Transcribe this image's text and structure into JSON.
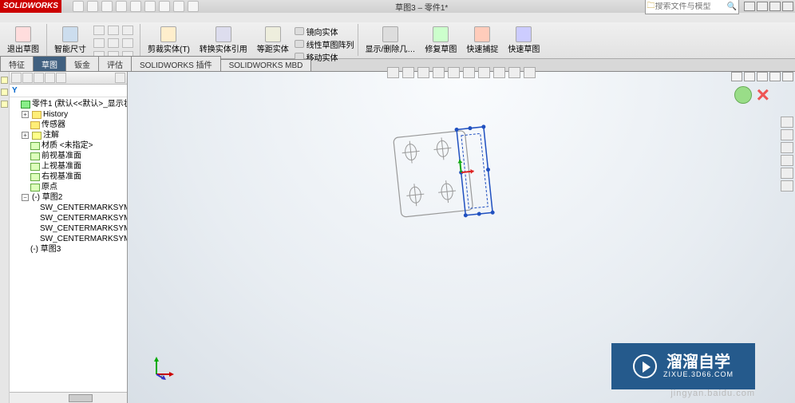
{
  "app": {
    "name": "SOLIDWORKS",
    "doc_title": "草图3 – 零件1*"
  },
  "search": {
    "placeholder": "搜索文件与模型"
  },
  "ribbon": {
    "exit_sketch": "退出草图",
    "smart_dim": "智能尺寸",
    "trim": "剪裁实体(T)",
    "convert": "转换实体引用",
    "offset": "等距实体",
    "mirror": "镜向实体",
    "linear_pattern": "线性草图阵列",
    "move": "移动实体",
    "display_delete": "显示/删除几…",
    "repair": "修复草图",
    "quick_snap": "快速捕捉",
    "quick_sketch": "快速草图"
  },
  "tabs": {
    "items": [
      "特征",
      "草图",
      "钣金",
      "评估",
      "SOLIDWORKS 插件",
      "SOLIDWORKS MBD"
    ],
    "active": 1
  },
  "tree": {
    "root": "零件1  (默认<<默认>_显示状态",
    "history": "History",
    "sensor": "传感器",
    "annot": "注解",
    "material": "材质 <未指定>",
    "front": "前视基准面",
    "top": "上视基准面",
    "right": "右视基准面",
    "origin": "原点",
    "sketch2": "(-) 草图2",
    "cm": "SW_CENTERMARKSYM",
    "sketch3": "(-) 草图3"
  },
  "watermark": {
    "brand": "溜溜自学",
    "url": "ZIXUE.3D66.COM"
  },
  "faint": "jingyan.baidu.com"
}
